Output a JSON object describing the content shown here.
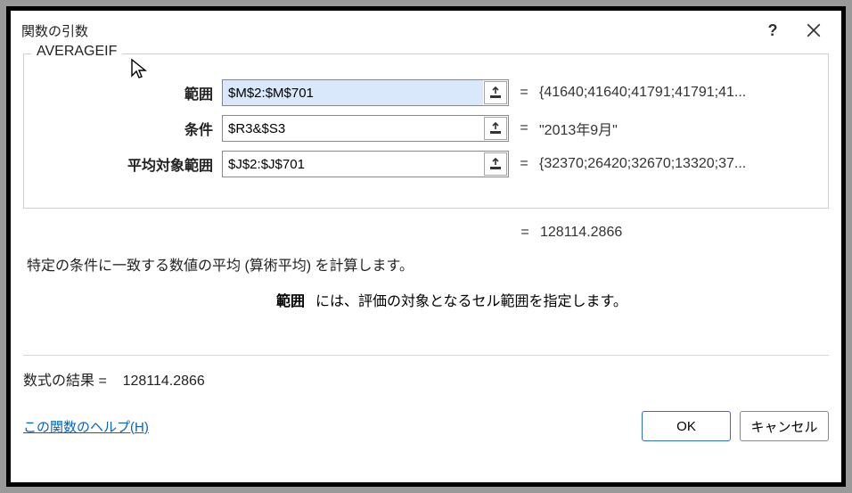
{
  "dialog": {
    "title": "関数の引数",
    "function_name": "AVERAGEIF",
    "arguments": [
      {
        "label": "範囲",
        "value": "$M$2:$M$701",
        "result": "{41640;41640;41791;41791;41...",
        "highlighted": true
      },
      {
        "label": "条件",
        "value": "$R3&$S3",
        "result": "\"2013年9月\"",
        "highlighted": false
      },
      {
        "label": "平均対象範囲",
        "value": "$J$2:$J$701",
        "result": "{32370;26420;32670;13320;37...",
        "highlighted": false
      }
    ],
    "eq": "=",
    "overall_result": "128114.2866",
    "description": "特定の条件に一致する数値の平均 (算術平均) を計算します。",
    "hint_label": "範囲",
    "hint_text": "には、評価の対象となるセル範囲を指定します。",
    "formula_result_label": "数式の結果 =",
    "formula_result_value": "128114.2866",
    "help_link": "この関数のヘルプ(H)",
    "ok_label": "OK",
    "cancel_label": "キャンセル"
  }
}
